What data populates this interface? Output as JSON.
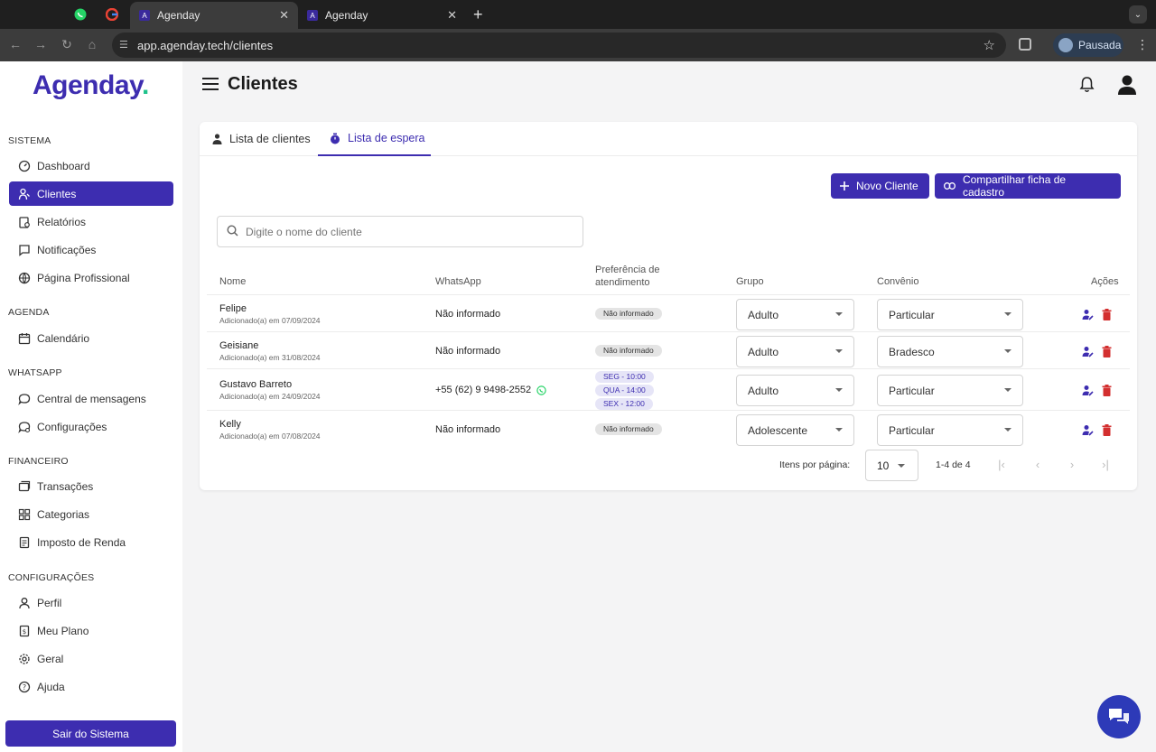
{
  "browser": {
    "tabs": [
      {
        "title": "Agenday"
      },
      {
        "title": "Agenday"
      }
    ],
    "url": "app.agenday.tech/clientes",
    "profile_label": "Pausada"
  },
  "sidebar": {
    "logo": "Agenday",
    "logo_dot": ".",
    "sections": [
      {
        "title": "SISTEMA",
        "items": [
          {
            "label": "Dashboard",
            "icon": "dashboard-icon"
          },
          {
            "label": "Clientes",
            "icon": "clients-icon",
            "active": true
          },
          {
            "label": "Relatórios",
            "icon": "reports-icon"
          },
          {
            "label": "Notificações",
            "icon": "notifications-icon"
          },
          {
            "label": "Página Profissional",
            "icon": "globe-icon"
          }
        ]
      },
      {
        "title": "AGENDA",
        "items": [
          {
            "label": "Calendário",
            "icon": "calendar-icon"
          }
        ]
      },
      {
        "title": "WHATSAPP",
        "items": [
          {
            "label": "Central de mensagens",
            "icon": "chat-icon"
          },
          {
            "label": "Configurações",
            "icon": "settings-icon"
          }
        ]
      },
      {
        "title": "FINANCEIRO",
        "items": [
          {
            "label": "Transações",
            "icon": "transactions-icon"
          },
          {
            "label": "Categorias",
            "icon": "categories-icon"
          },
          {
            "label": "Imposto de Renda",
            "icon": "tax-icon"
          }
        ]
      },
      {
        "title": "CONFIGURAÇÕES",
        "items": [
          {
            "label": "Perfil",
            "icon": "profile-icon"
          },
          {
            "label": "Meu Plano",
            "icon": "plan-icon"
          },
          {
            "label": "Geral",
            "icon": "gear-icon"
          },
          {
            "label": "Ajuda",
            "icon": "help-icon"
          }
        ]
      }
    ],
    "logout_label": "Sair do Sistema"
  },
  "header": {
    "title": "Clientes"
  },
  "tabs": [
    {
      "label": "Lista de clientes"
    },
    {
      "label": "Lista de espera",
      "active": true
    }
  ],
  "actions": {
    "new_client": "Novo Cliente",
    "share_form": "Compartilhar ficha de cadastro"
  },
  "search": {
    "placeholder": "Digite o nome do cliente"
  },
  "table": {
    "columns": {
      "name": "Nome",
      "whatsapp": "WhatsApp",
      "preference_1": "Preferência de",
      "preference_2": "atendimento",
      "group": "Grupo",
      "insurance": "Convênio",
      "actions": "Ações"
    },
    "rows": [
      {
        "name": "Felipe",
        "added": "Adicionado(a) em 07/09/2024",
        "whatsapp": "Não informado",
        "preference": [
          "Não informado"
        ],
        "group": "Adulto",
        "insurance": "Particular"
      },
      {
        "name": "Geisiane",
        "added": "Adicionado(a) em 31/08/2024",
        "whatsapp": "Não informado",
        "preference": [
          "Não informado"
        ],
        "group": "Adulto",
        "insurance": "Bradesco"
      },
      {
        "name": "Gustavo Barreto",
        "added": "Adicionado(a) em 24/09/2024",
        "whatsapp": "+55 (62) 9 9498-2552",
        "preference": [
          "SEG - 10:00",
          "QUA - 14:00",
          "SEX - 12:00"
        ],
        "group": "Adulto",
        "insurance": "Particular"
      },
      {
        "name": "Kelly",
        "added": "Adicionado(a) em 07/08/2024",
        "whatsapp": "Não informado",
        "preference": [
          "Não informado"
        ],
        "group": "Adolescente",
        "insurance": "Particular"
      }
    ]
  },
  "pagination": {
    "items_per_page_label": "Itens por página:",
    "items_per_page": "10",
    "range": "1-4 de 4"
  },
  "colors": {
    "brand": "#3d2db0",
    "accent_green": "#1ec28b",
    "delete": "#d32f2f"
  }
}
